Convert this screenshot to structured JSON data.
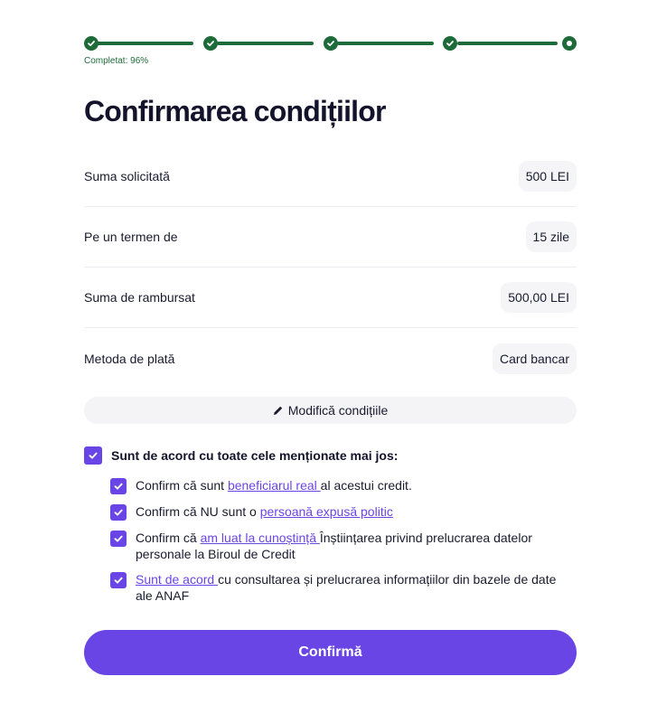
{
  "progress": {
    "label": "Completat: 96%",
    "percent": 96,
    "steps_total": 5,
    "steps_done": 4
  },
  "title": "Confirmarea condițiilor",
  "summary": [
    {
      "label": "Suma solicitată",
      "value": "500 LEI"
    },
    {
      "label": "Pe un termen de",
      "value": "15 zile"
    },
    {
      "label": "Suma de rambursat",
      "value": "500,00 LEI"
    },
    {
      "label": "Metoda de plată",
      "value": "Card bancar"
    }
  ],
  "modify_label": "Modifică condițiile",
  "agree_all": {
    "label": "Sunt de acord cu toate cele menționate mai jos:",
    "checked": true
  },
  "consents": [
    {
      "before": "Confirm că sunt ",
      "link": "beneficiarul real ",
      "after": "al acestui credit.",
      "checked": true
    },
    {
      "before": "Confirm că NU sunt o ",
      "link": "persoană expusă politic",
      "after": "",
      "checked": true
    },
    {
      "before": "Confirm că ",
      "link": "am luat la cunoștință ",
      "after": "Înștiințarea privind prelucrarea datelor personale la Biroul de Credit",
      "checked": true
    },
    {
      "before": "",
      "link": "Sunt de acord ",
      "after": "cu consultarea și prelucrarea informațiilor din bazele de date ale ANAF",
      "checked": true
    }
  ],
  "confirm_label": "Confirmă",
  "colors": {
    "accent": "#6a45e5",
    "progress": "#1e6b3a"
  }
}
